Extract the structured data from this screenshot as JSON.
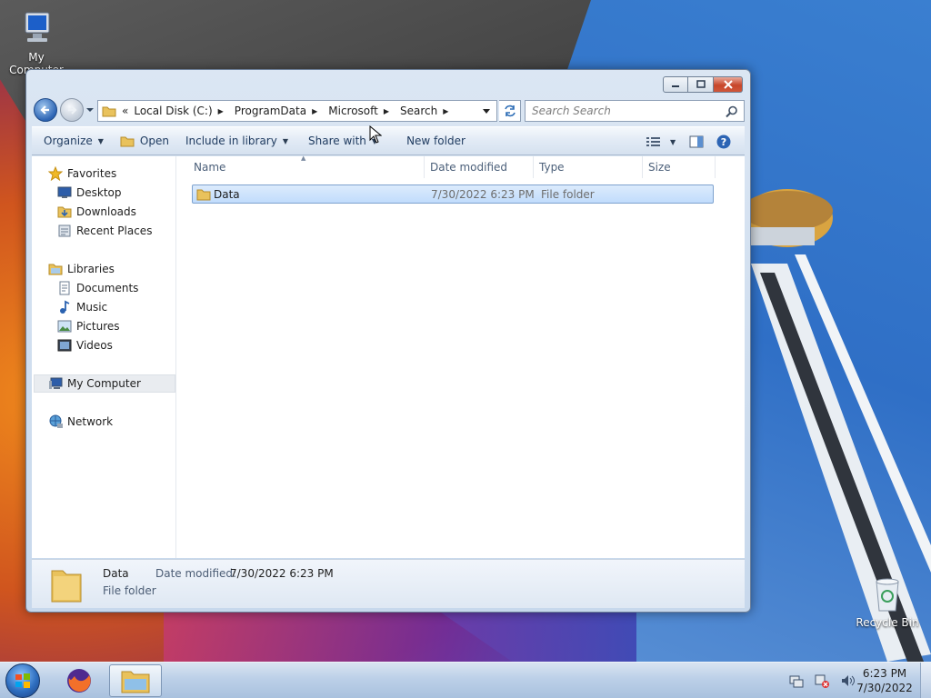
{
  "desktop": {
    "icons": [
      {
        "label": "My Computer"
      },
      {
        "label": "Recycle Bin"
      }
    ]
  },
  "window": {
    "address": {
      "overflow": "«",
      "crumbs": [
        "Local Disk (C:)",
        "ProgramData",
        "Microsoft",
        "Search"
      ]
    },
    "search": {
      "placeholder": "Search Search"
    },
    "toolbar": {
      "organize": "Organize",
      "open": "Open",
      "include": "Include in library",
      "share": "Share with",
      "new_folder": "New folder"
    },
    "nav": {
      "favorites": "Favorites",
      "desktop": "Desktop",
      "downloads": "Downloads",
      "recent": "Recent Places",
      "libraries": "Libraries",
      "documents": "Documents",
      "music": "Music",
      "pictures": "Pictures",
      "videos": "Videos",
      "computer": "My Computer",
      "network": "Network"
    },
    "columns": [
      "Name",
      "Date modified",
      "Type",
      "Size"
    ],
    "rows": [
      {
        "name": "Data",
        "date": "7/30/2022 6:23 PM",
        "type": "File folder",
        "size": ""
      }
    ],
    "details": {
      "name": "Data",
      "kind": "File folder",
      "date_label": "Date modified:",
      "date_value": "7/30/2022 6:23 PM"
    }
  },
  "taskbar": {
    "time": "6:23 PM",
    "date": "7/30/2022"
  },
  "colors": {
    "selection": "#c1dcfc",
    "accent": "#2c64b4"
  }
}
